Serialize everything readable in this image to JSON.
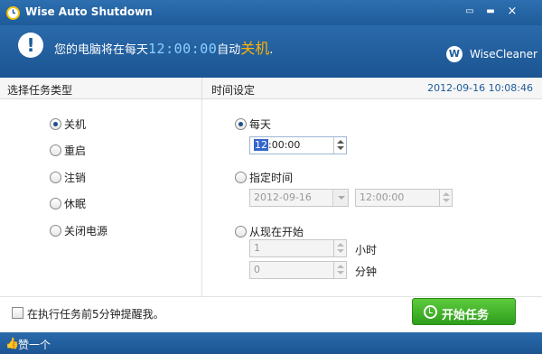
{
  "window": {
    "title": "Wise Auto Shutdown",
    "controls": {
      "minimize": "▭",
      "maximize": "▬",
      "close": "×"
    }
  },
  "banner": {
    "message_prefix": "您的电脑将在每天",
    "time": "12:00:00",
    "message_mid": "自动",
    "action": "关机",
    "message_suffix": ".",
    "brand": "WiseCleaner",
    "brand_logo": "W"
  },
  "left_panel": {
    "header": "选择任务类型",
    "options": [
      {
        "label": "关机",
        "checked": true
      },
      {
        "label": "重启",
        "checked": false
      },
      {
        "label": "注销",
        "checked": false
      },
      {
        "label": "休眠",
        "checked": false
      },
      {
        "label": "关闭电源",
        "checked": false
      }
    ]
  },
  "right_panel": {
    "header": "时间设定",
    "datetime": "2012-09-16  10:08:46",
    "daily": {
      "label": "每天",
      "checked": true,
      "hour": "12",
      "rest": ":00:00"
    },
    "specific": {
      "label": "指定时间",
      "checked": false,
      "date": "2012-09-16",
      "time": "12:00:00"
    },
    "from_now": {
      "label": "从现在开始",
      "checked": false,
      "hours": "1",
      "hours_unit": "小时",
      "minutes": "0",
      "minutes_unit": "分钟"
    }
  },
  "bottom": {
    "remind_label": "在执行任务前5分钟提醒我。",
    "remind_checked": false,
    "start_button": "开始任务"
  },
  "footer": {
    "like_label": "赞一个",
    "icon": "thumbs-up-icon"
  },
  "colors": {
    "title_bar": "#1e5b99",
    "time_highlight": "#8cd0ff",
    "action_highlight": "#ffb400",
    "start_button": "#3aae24",
    "datetime_text": "#1e5b99"
  }
}
